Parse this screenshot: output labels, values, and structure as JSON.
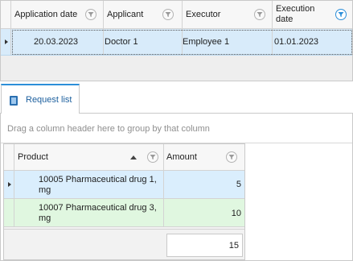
{
  "top_grid": {
    "columns": [
      "Application date",
      "Applicant",
      "Executor",
      "Execution date"
    ],
    "execution_date_header": [
      "Execution",
      "date"
    ],
    "row": {
      "application_date": "20.03.2023",
      "applicant": "Doctor 1",
      "executor": "Employee 1",
      "execution_date": "01.01.2023"
    },
    "filter_icon": "filter-funnel-icon",
    "active_filter_color": "#2d8fd9",
    "selected_row_color": "#d8ebfa"
  },
  "tab": {
    "label": "Request list",
    "icon": "book-icon"
  },
  "group_panel": {
    "hint": "Drag a column header here to group by that column"
  },
  "request_grid": {
    "columns": {
      "product": "Product",
      "amount": "Amount"
    },
    "sort": {
      "column": "Product",
      "direction": "ascending"
    },
    "rows": [
      {
        "product": "10005 Pharmaceutical drug 1, mg",
        "amount": "5",
        "color": "#daeefd"
      },
      {
        "product": "10007 Pharmaceutical drug 3, mg",
        "amount": "10",
        "color": "#e0f7e0"
      }
    ],
    "total_amount": "15"
  }
}
